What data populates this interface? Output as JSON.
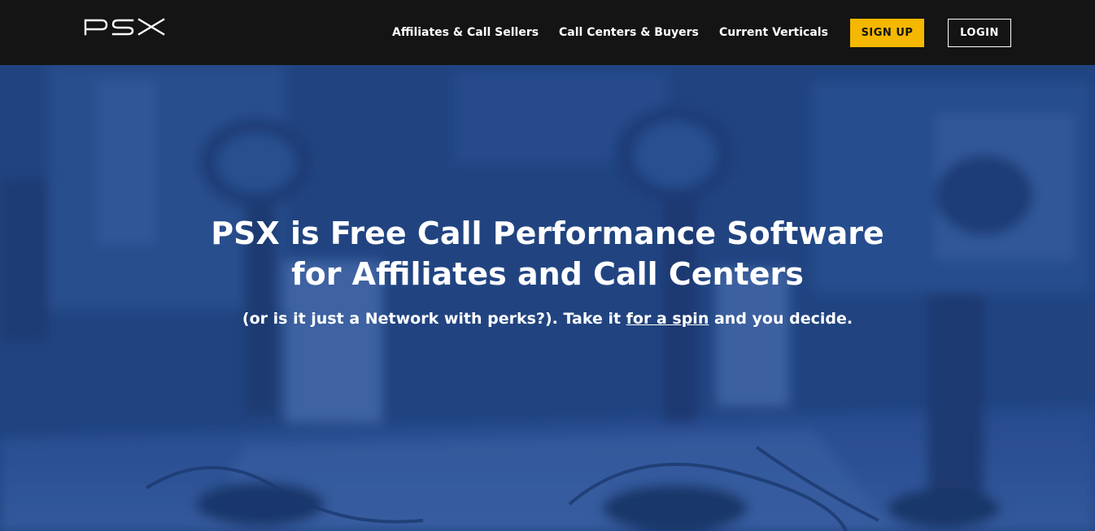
{
  "header": {
    "logo_text": "PSX",
    "nav": [
      {
        "label": "Affiliates & Call Sellers"
      },
      {
        "label": "Call Centers & Buyers"
      },
      {
        "label": "Current Verticals"
      }
    ],
    "signup_label": "SIGN UP",
    "login_label": "LOGIN"
  },
  "hero": {
    "title_line1": "PSX is Free Call Performance Software",
    "title_line2": "for Affiliates and Call Centers",
    "subtitle_before": "(or is it just a Network with perks?). Take it ",
    "subtitle_link": "for a spin",
    "subtitle_after": " and you decide."
  },
  "colors": {
    "topbar": "#141414",
    "hero_overlay": "#23478a",
    "signup_accent": "#f5b800",
    "text": "#ffffff"
  }
}
